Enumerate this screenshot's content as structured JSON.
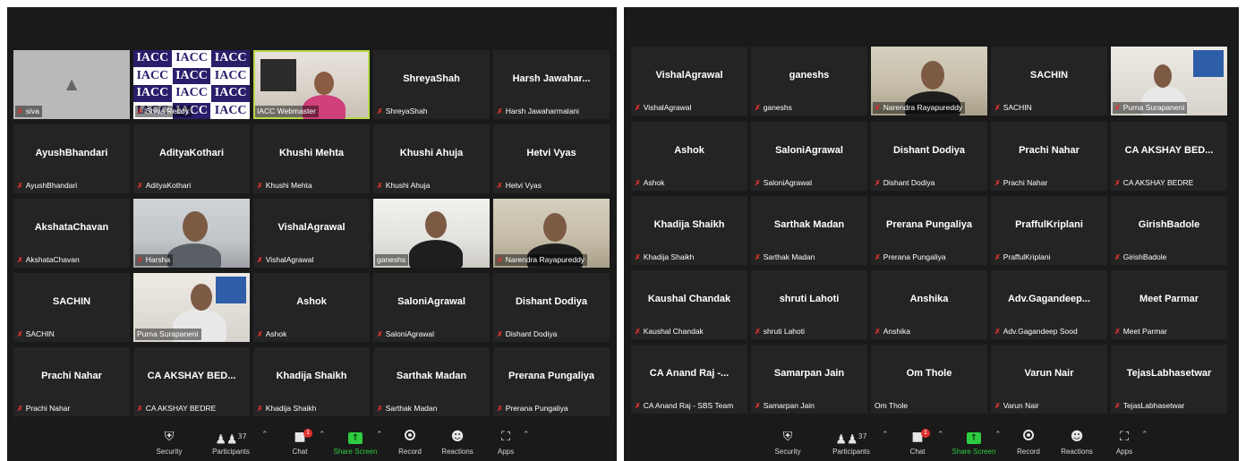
{
  "left": {
    "tiles": [
      {
        "label": "siva"
      },
      {
        "label": "Shiva Reddy",
        "iacc": "IACC"
      },
      {
        "label": "IACC Webmaster"
      },
      {
        "name": "ShreyaShah",
        "label": "ShreyaShah"
      },
      {
        "name": "Harsh Jawahar...",
        "label": "Harsh Jawaharmalani"
      },
      {
        "name": "AyushBhandari",
        "label": "AyushBhandari"
      },
      {
        "name": "AdityaKothari",
        "label": "AdityaKothari"
      },
      {
        "name": "Khushi Mehta",
        "label": "Khushi Mehta"
      },
      {
        "name": "Khushi Ahuja",
        "label": "Khushi Ahuja"
      },
      {
        "name": "Hetvi Vyas",
        "label": "Hetvi Vyas"
      },
      {
        "name": "AkshataChavan",
        "label": "AkshataChavan"
      },
      {
        "label": "Harsha"
      },
      {
        "name": "VishalAgrawal",
        "label": "VishalAgrawal"
      },
      {
        "label": "ganeshs"
      },
      {
        "label": "Narendra Rayapureddy"
      },
      {
        "name": "SACHIN",
        "label": "SACHIN"
      },
      {
        "label": "Purna Surapaneni"
      },
      {
        "name": "Ashok",
        "label": "Ashok"
      },
      {
        "name": "SaloniAgrawal",
        "label": "SaloniAgrawal"
      },
      {
        "name": "Dishant Dodiya",
        "label": "Dishant Dodiya"
      },
      {
        "name": "Prachi Nahar",
        "label": "Prachi Nahar"
      },
      {
        "name": "CA AKSHAY BED...",
        "label": "CA AKSHAY BEDRE"
      },
      {
        "name": "Khadija Shaikh",
        "label": "Khadija Shaikh"
      },
      {
        "name": "Sarthak Madan",
        "label": "Sarthak Madan"
      },
      {
        "name": "Prerana Pungaliya",
        "label": "Prerana Pungaliya"
      }
    ]
  },
  "right": {
    "tiles": [
      {
        "name": "VishalAgrawal",
        "label": "VishalAgrawal"
      },
      {
        "name": "ganeshs",
        "label": "ganeshs"
      },
      {
        "label": "Narendra Rayapureddy"
      },
      {
        "name": "SACHIN",
        "label": "SACHIN"
      },
      {
        "label": "Purna Surapaneni"
      },
      {
        "name": "Ashok",
        "label": "Ashok"
      },
      {
        "name": "SaloniAgrawal",
        "label": "SaloniAgrawal"
      },
      {
        "name": "Dishant Dodiya",
        "label": "Dishant Dodiya"
      },
      {
        "name": "Prachi Nahar",
        "label": "Prachi Nahar"
      },
      {
        "name": "CA AKSHAY BED...",
        "label": "CA AKSHAY BEDRE"
      },
      {
        "name": "Khadija Shaikh",
        "label": "Khadija Shaikh"
      },
      {
        "name": "Sarthak Madan",
        "label": "Sarthak Madan"
      },
      {
        "name": "Prerana Pungaliya",
        "label": "Prerana Pungaliya"
      },
      {
        "name": "PraffulKriplani",
        "label": "PraffulKriplani"
      },
      {
        "name": "GirishBadole",
        "label": "GirishBadole"
      },
      {
        "name": "Kaushal Chandak",
        "label": "Kaushal Chandak"
      },
      {
        "name": "shruti Lahoti",
        "label": "shruti Lahoti"
      },
      {
        "name": "Anshika",
        "label": "Anshika"
      },
      {
        "name": "Adv.Gagandeep...",
        "label": "Adv.Gagandeep Sood"
      },
      {
        "name": "Meet Parmar",
        "label": "Meet Parmar"
      },
      {
        "name": "CA Anand Raj -...",
        "label": "CA Anand Raj - SBS Team"
      },
      {
        "name": "Samarpan Jain",
        "label": "Samarpan Jain"
      },
      {
        "name": "Om Thole",
        "label": "Om Thole"
      },
      {
        "name": "Varun Nair",
        "label": "Varun Nair"
      },
      {
        "name": "TejasLabhasetwar",
        "label": "TejasLabhasetwar"
      }
    ]
  },
  "toolbar": {
    "security": "Security",
    "participants": "Participants",
    "participants_count": "37",
    "chat": "Chat",
    "chat_badge": "1",
    "share_screen": "Share Screen",
    "record": "Record",
    "reactions": "Reactions",
    "apps": "Apps"
  },
  "colors": {
    "accent_green": "#2ecc40",
    "muted_red": "#e0312e",
    "active_speaker": "#b7d94a",
    "iacc_purple": "#2b1d6a"
  },
  "icons": {
    "security": "shield-icon",
    "participants": "people-icon",
    "chat": "chat-bubble-icon",
    "share": "share-screen-icon",
    "record": "record-icon",
    "reactions": "reaction-icon",
    "apps": "apps-icon",
    "muted": "muted-mic-icon"
  }
}
